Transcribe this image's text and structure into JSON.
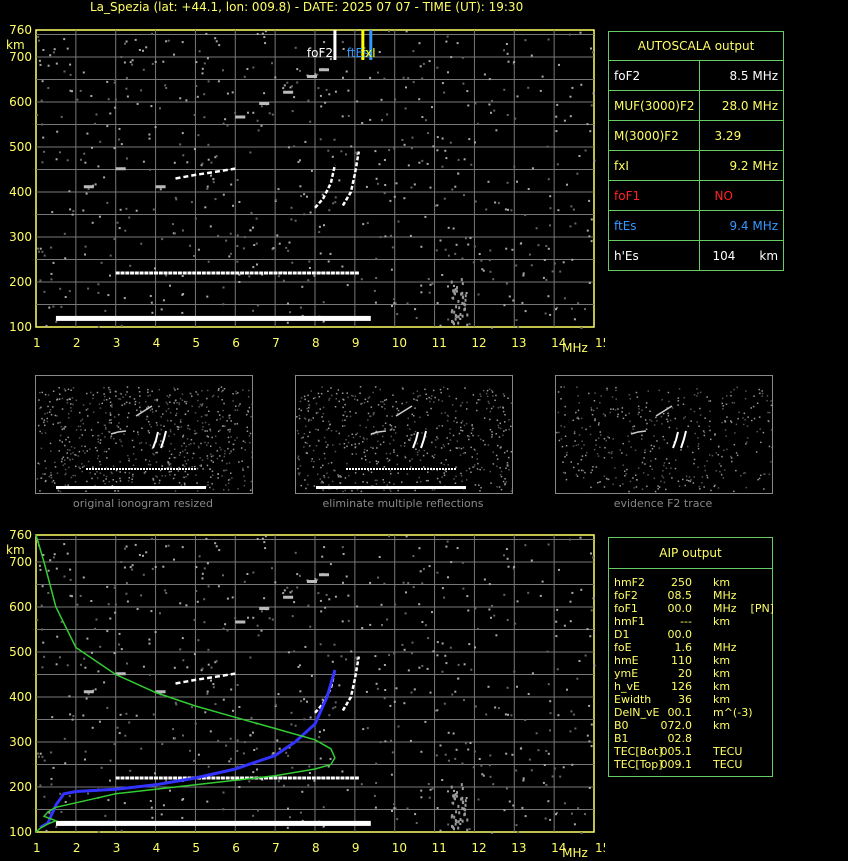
{
  "header": {
    "title": "La_Spezia (lat: +44.1, lon: 009.8) - DATE: 2025 07 07 - TIME (UT): 19:30"
  },
  "chart_data": [
    {
      "type": "scatter",
      "title": "",
      "xlabel": "MHz",
      "ylabel": "km",
      "xlim": [
        1,
        15
      ],
      "ylim": [
        100,
        760
      ],
      "xticks": [
        "1",
        "2",
        "3",
        "4",
        "5",
        "6",
        "7",
        "8",
        "9",
        "10",
        "11",
        "12",
        "13",
        "14",
        "15"
      ],
      "yticks": [
        "100",
        "200",
        "300",
        "400",
        "500",
        "600",
        "700",
        "760"
      ],
      "grid": true,
      "markers": [
        {
          "label": "foF2",
          "x": 8.5,
          "color": "#ffffff"
        },
        {
          "label": "ftEs",
          "x": 9.4,
          "color": "#3399ff"
        },
        {
          "label": "fxI",
          "x": 9.2,
          "color": "#ffff00"
        }
      ],
      "traces": [
        {
          "name": "Es",
          "x": [
            1.5,
            9.4
          ],
          "y": [
            118,
            118
          ]
        },
        {
          "name": "2Es",
          "x": [
            3.0,
            9.0
          ],
          "y": [
            220,
            220
          ]
        },
        {
          "name": "F-o",
          "x": [
            8.0,
            8.2,
            8.4,
            8.5
          ],
          "y": [
            365,
            385,
            420,
            460
          ]
        },
        {
          "name": "F-x",
          "x": [
            8.7,
            8.9,
            9.0,
            9.1
          ],
          "y": [
            370,
            400,
            440,
            490
          ]
        },
        {
          "name": "2F",
          "x": [
            4.5,
            5.0,
            5.5,
            6.0
          ],
          "y": [
            430,
            438,
            445,
            452
          ]
        }
      ]
    },
    {
      "type": "line",
      "title": "",
      "xlabel": "MHz",
      "ylabel": "km",
      "xlim": [
        1,
        15
      ],
      "ylim": [
        100,
        760
      ],
      "grid": true,
      "series": [
        {
          "color": "#3333ff",
          "x": [
            1.1,
            1.3,
            1.5,
            1.7,
            2.0,
            3.0,
            4.0,
            5.0,
            6.0,
            7.0,
            7.5,
            8.0,
            8.3,
            8.5
          ],
          "y": [
            110,
            120,
            160,
            185,
            190,
            195,
            205,
            220,
            240,
            270,
            300,
            340,
            400,
            460
          ]
        },
        {
          "color": "#33cc33",
          "x": [
            1.0,
            1.2,
            1.5,
            2.0,
            3.0,
            4.0,
            5.0,
            6.0,
            7.0,
            8.0,
            8.4,
            8.5,
            8.4,
            8.0,
            7.0,
            6.0,
            5.0,
            4.0,
            3.0,
            2.5,
            2.0,
            1.5,
            1.3,
            1.2,
            1.5,
            1.3,
            1.1,
            1.0
          ],
          "y": [
            760,
            700,
            600,
            510,
            450,
            410,
            380,
            355,
            330,
            305,
            285,
            265,
            250,
            240,
            225,
            215,
            205,
            195,
            185,
            175,
            165,
            155,
            145,
            135,
            125,
            118,
            108,
            100
          ]
        }
      ]
    }
  ],
  "autoscala": {
    "title": "AUTOSCALA output",
    "rows": [
      {
        "label": "foF2",
        "value": "8.5 MHz",
        "color": "#ffffff"
      },
      {
        "label": "MUF(3000)F2",
        "value": "28.0 MHz",
        "color": "#ffff66"
      },
      {
        "label": "M(3000)F2",
        "value": "3.29",
        "color": "#ffff66"
      },
      {
        "label": "fxI",
        "value": "9.2 MHz",
        "color": "#ffff66"
      },
      {
        "label": "foF1",
        "value": "NO",
        "color": "#ff2222"
      },
      {
        "label": "ftEs",
        "value": "9.4 MHz",
        "color": "#3399ff"
      },
      {
        "label": "h'Es",
        "value": "104",
        "unit": "km",
        "color": "#ffffff"
      }
    ]
  },
  "thumbnails": [
    {
      "caption": "original ionogram resized"
    },
    {
      "caption": "eliminate multiple reflections"
    },
    {
      "caption": "evidence F2 trace"
    }
  ],
  "aip": {
    "title": "AIP output",
    "rows": [
      {
        "label": "hmF2",
        "value": "250",
        "unit": "km"
      },
      {
        "label": "foF2",
        "value": "08.5",
        "unit": "MHz"
      },
      {
        "label": "foF1",
        "value": "00.0",
        "unit": "MHz    [PN]"
      },
      {
        "label": "hmF1",
        "value": "---",
        "unit": "km"
      },
      {
        "label": "D1",
        "value": "00.0",
        "unit": ""
      },
      {
        "label": "foE",
        "value": "1.6",
        "unit": "MHz"
      },
      {
        "label": "hmE",
        "value": "110",
        "unit": "km"
      },
      {
        "label": "ymE",
        "value": "20",
        "unit": "km"
      },
      {
        "label": "h_vE",
        "value": "126",
        "unit": "km"
      },
      {
        "label": "Ewidth",
        "value": "36",
        "unit": "km"
      },
      {
        "label": "DelN_vE",
        "value": "00.1",
        "unit": "m^(-3)"
      },
      {
        "label": "B0",
        "value": "072.0",
        "unit": "km"
      },
      {
        "label": "B1",
        "value": "02.8",
        "unit": ""
      },
      {
        "label": "TEC[Bot]",
        "value": "005.1",
        "unit": "TECU"
      },
      {
        "label": "TEC[Top]",
        "value": "009.1",
        "unit": "TECU"
      }
    ]
  }
}
